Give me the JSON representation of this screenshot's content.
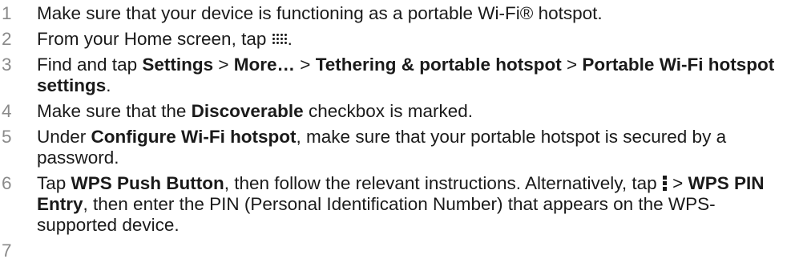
{
  "steps": [
    {
      "num": "1",
      "parts": [
        {
          "text": "Make sure that your device is functioning as a portable Wi-Fi® hotspot."
        }
      ]
    },
    {
      "num": "2",
      "parts": [
        {
          "text": "From your Home screen, tap "
        },
        {
          "icon": "apps-grid-icon"
        },
        {
          "text": "."
        }
      ]
    },
    {
      "num": "3",
      "parts": [
        {
          "text": "Find and tap "
        },
        {
          "text": "Settings",
          "bold": true
        },
        {
          "text": " > "
        },
        {
          "text": "More…",
          "bold": true
        },
        {
          "text": " > "
        },
        {
          "text": "Tethering & portable hotspot",
          "bold": true
        },
        {
          "text": " > "
        },
        {
          "text": "Portable Wi-Fi hotspot settings",
          "bold": true
        },
        {
          "text": "."
        }
      ]
    },
    {
      "num": "4",
      "parts": [
        {
          "text": "Make sure that the "
        },
        {
          "text": "Discoverable",
          "bold": true
        },
        {
          "text": " checkbox is marked."
        }
      ]
    },
    {
      "num": "5",
      "parts": [
        {
          "text": "Under "
        },
        {
          "text": "Configure Wi-Fi hotspot",
          "bold": true
        },
        {
          "text": ", make sure that your portable hotspot is secured by a password."
        }
      ]
    },
    {
      "num": "6",
      "parts": [
        {
          "text": "Tap "
        },
        {
          "text": "WPS Push Button",
          "bold": true
        },
        {
          "text": ", then follow the relevant instructions. Alternatively, tap "
        },
        {
          "icon": "menu-dots-icon"
        },
        {
          "text": " > "
        },
        {
          "text": "WPS PIN Entry",
          "bold": true
        },
        {
          "text": ", then enter the PIN (Personal Identification Number) that appears on the WPS-supported device."
        }
      ]
    },
    {
      "num": "7",
      "parts": []
    }
  ]
}
